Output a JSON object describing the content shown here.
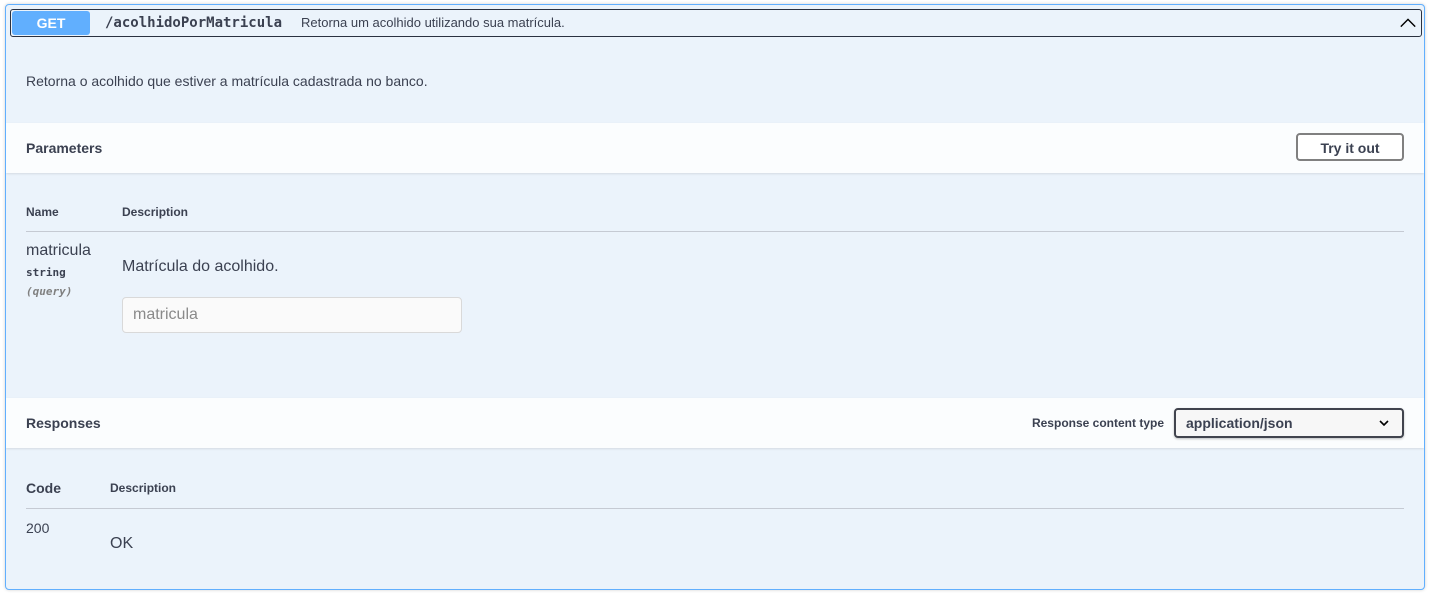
{
  "operation": {
    "method": "GET",
    "path": "/acolhidoPorMatricula",
    "summary": "Retorna um acolhido utilizando sua matrícula.",
    "description": "Retorna o acolhido que estiver a matrícula cadastrada no banco.",
    "expanded_icon": "chevron-up-icon"
  },
  "parameters": {
    "title": "Parameters",
    "try_label": "Try it out",
    "col_name": "Name",
    "col_description": "Description",
    "items": [
      {
        "name": "matricula",
        "type": "string",
        "in": "(query)",
        "description": "Matrícula do acolhido.",
        "placeholder": "matricula",
        "value": ""
      }
    ]
  },
  "responses": {
    "title": "Responses",
    "content_type_label": "Response content type",
    "content_type_value": "application/json",
    "dropdown_icon": "chevron-down-icon",
    "col_code": "Code",
    "col_description": "Description",
    "items": [
      {
        "code": "200",
        "description": "OK"
      }
    ]
  },
  "colors": {
    "get_accent": "#61affe",
    "block_bg": "#ebf3fb",
    "text": "#3b4151"
  }
}
